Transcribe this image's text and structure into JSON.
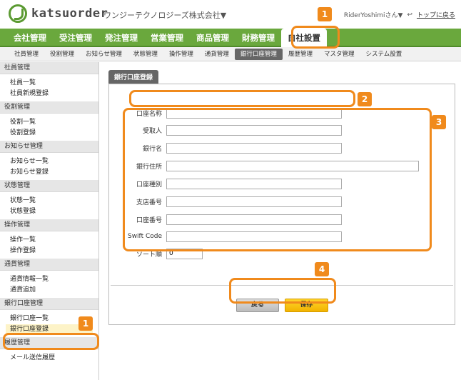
{
  "header": {
    "logo_text": "katsuorder",
    "company": "ワンジーテクノロジーズ株式会社▼",
    "user": "RiderYoshimiさん▼",
    "back_icon": "return-arrow-icon",
    "top_link": "トップに戻る"
  },
  "mainnav": [
    "会社管理",
    "受注管理",
    "発注管理",
    "営業管理",
    "商品管理",
    "財務管理",
    "自社設置"
  ],
  "subnav": [
    "社員管理",
    "役割管理",
    "お知らせ管理",
    "状態管理",
    "操作管理",
    "通貨管理",
    "銀行口座管理",
    "履歴管理",
    "マスタ管理",
    "システム設置"
  ],
  "sidebar": [
    {
      "head": "社員管理",
      "items": [
        "社員一覧",
        "社員新規登録"
      ]
    },
    {
      "head": "役割管理",
      "items": [
        "役割一覧",
        "役割登録"
      ]
    },
    {
      "head": "お知らせ管理",
      "items": [
        "お知らせ一覧",
        "お知らせ登録"
      ]
    },
    {
      "head": "状態管理",
      "items": [
        "状態一覧",
        "状態登録"
      ]
    },
    {
      "head": "操作管理",
      "items": [
        "操作一覧",
        "操作登録"
      ]
    },
    {
      "head": "通貨管理",
      "items": [
        "通貨情報一覧",
        "通貨追加"
      ]
    },
    {
      "head": "銀行口座管理",
      "items": [
        "銀行口座一覧",
        "銀行口座登録"
      ]
    },
    {
      "head": "履歴管理",
      "items": [
        "メール送信履歴"
      ]
    }
  ],
  "form": {
    "tab": "銀行口座登録",
    "fields": {
      "account_name": {
        "label": "口座名称",
        "value": ""
      },
      "recipient": {
        "label": "受取人",
        "value": ""
      },
      "bank_name": {
        "label": "銀行名",
        "value": ""
      },
      "bank_address": {
        "label": "銀行住所",
        "value": ""
      },
      "account_type": {
        "label": "口座種別",
        "value": ""
      },
      "branch_no": {
        "label": "支店番号",
        "value": ""
      },
      "account_no": {
        "label": "口座番号",
        "value": ""
      },
      "swift": {
        "label": "Swift Code",
        "value": ""
      },
      "sort": {
        "label": "ソート順",
        "value": "0"
      }
    },
    "back_label": "戻る",
    "save_label": "保存"
  },
  "annotations": [
    "1",
    "1",
    "2",
    "3",
    "4"
  ],
  "colors": {
    "accent": "#6aa83d",
    "highlight": "#f08a1c",
    "save": "#f2b300"
  }
}
